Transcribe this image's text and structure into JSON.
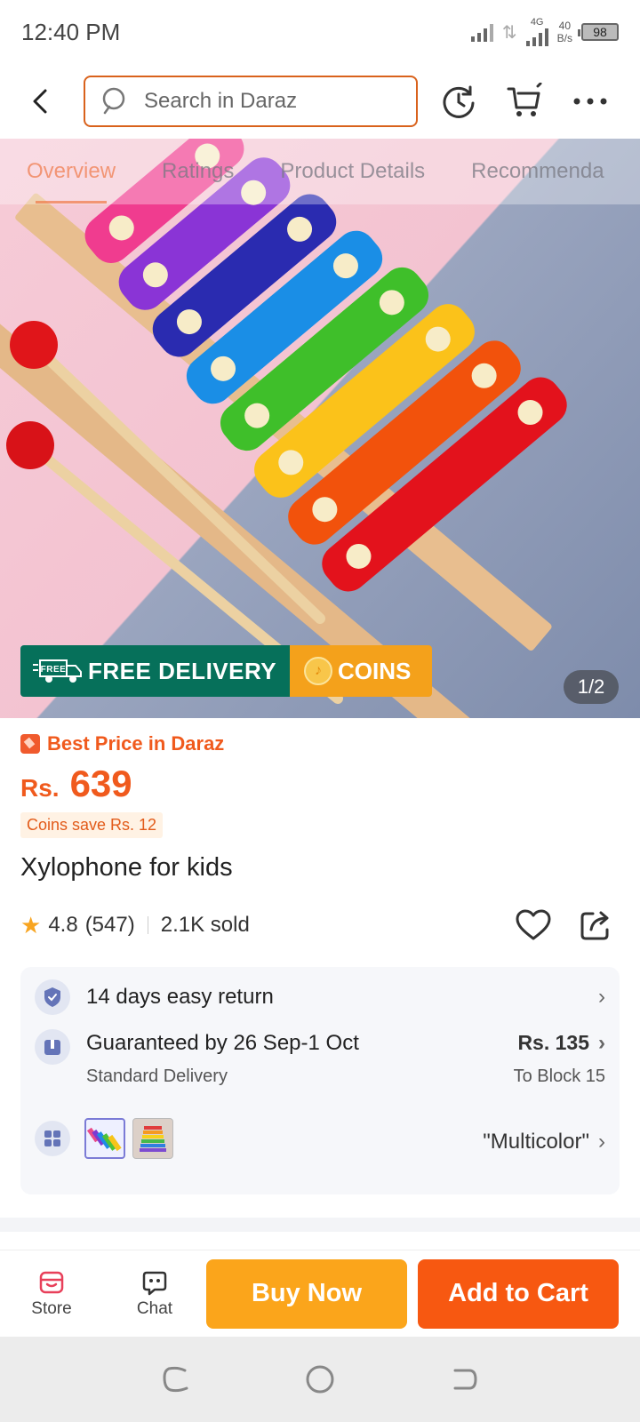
{
  "status_bar": {
    "time": "12:40 PM",
    "network_label": "4G",
    "speed_value": "40",
    "speed_unit": "B/s",
    "battery": "98"
  },
  "header": {
    "search_placeholder": "Search in Daraz",
    "accent_color": "#d9621c"
  },
  "gallery": {
    "tabs": [
      "Overview",
      "Ratings",
      "Product Details",
      "Recommenda"
    ],
    "active_tab": "Overview",
    "free_delivery_label": "FREE DELIVERY",
    "free_truck_text": "FREE",
    "coins_label": "COINS",
    "page_indicator": "1/2"
  },
  "product": {
    "best_price_label": "Best Price in Daraz",
    "currency": "Rs.",
    "price": "639",
    "coins_save": "Coins save Rs. 12",
    "title": "Xylophone for kids",
    "rating": "4.8",
    "rating_count": "(547)",
    "sold": "2.1K sold"
  },
  "info": {
    "returns": "14 days easy return",
    "delivery_main": "Guaranteed by 26 Sep-1 Oct",
    "delivery_sub": "Standard Delivery",
    "delivery_price": "Rs. 135",
    "delivery_location": "To Block 15",
    "variant": "\"Multicolor\""
  },
  "bottom_bar": {
    "store_label": "Store",
    "chat_label": "Chat",
    "buy_now_label": "Buy Now",
    "add_to_cart_label": "Add to Cart",
    "buy_color": "#fba51b",
    "cart_color": "#f75811"
  }
}
